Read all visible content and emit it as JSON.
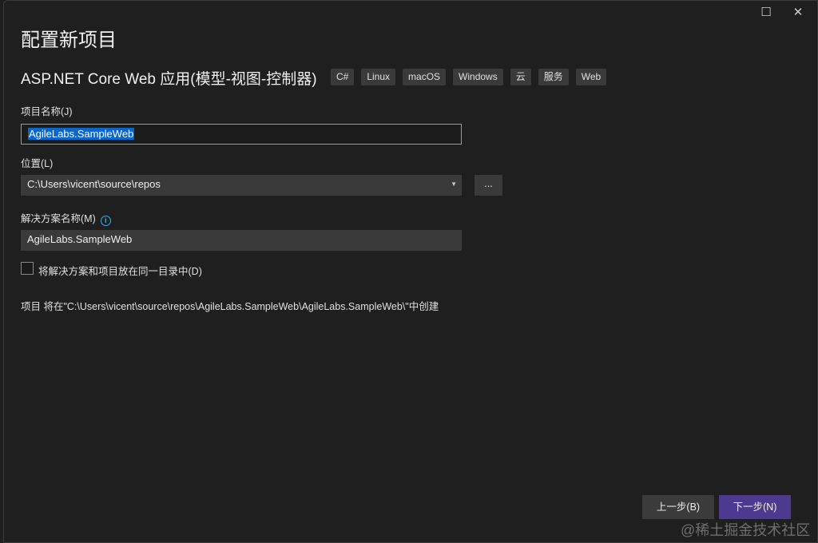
{
  "window": {
    "maximize_icon": "maximize-icon",
    "close_icon": "close-icon"
  },
  "title": "配置新项目",
  "template": {
    "name": "ASP.NET Core Web 应用(模型-视图-控制器)",
    "tags": [
      "C#",
      "Linux",
      "macOS",
      "Windows",
      "云",
      "服务",
      "Web"
    ]
  },
  "project_name": {
    "label": "项目名称(J)",
    "value": "AgileLabs.SampleWeb"
  },
  "location": {
    "label": "位置(L)",
    "value": "C:\\Users\\vicent\\source\\repos",
    "browse_label": "..."
  },
  "solution_name": {
    "label": "解决方案名称(M)",
    "value": "AgileLabs.SampleWeb",
    "info_icon": "info-icon"
  },
  "same_dir": {
    "label": "将解决方案和项目放在同一目录中(D)",
    "checked": false
  },
  "path_info": "项目 将在\"C:\\Users\\vicent\\source\\repos\\AgileLabs.SampleWeb\\AgileLabs.SampleWeb\\\"中创建",
  "buttons": {
    "back": "上一步(B)",
    "next": "下一步(N)"
  },
  "watermark": "@稀土掘金技术社区",
  "colors": {
    "accent": "#4b3a8f",
    "selection": "#0a66c8",
    "background": "#1f1f1f"
  }
}
